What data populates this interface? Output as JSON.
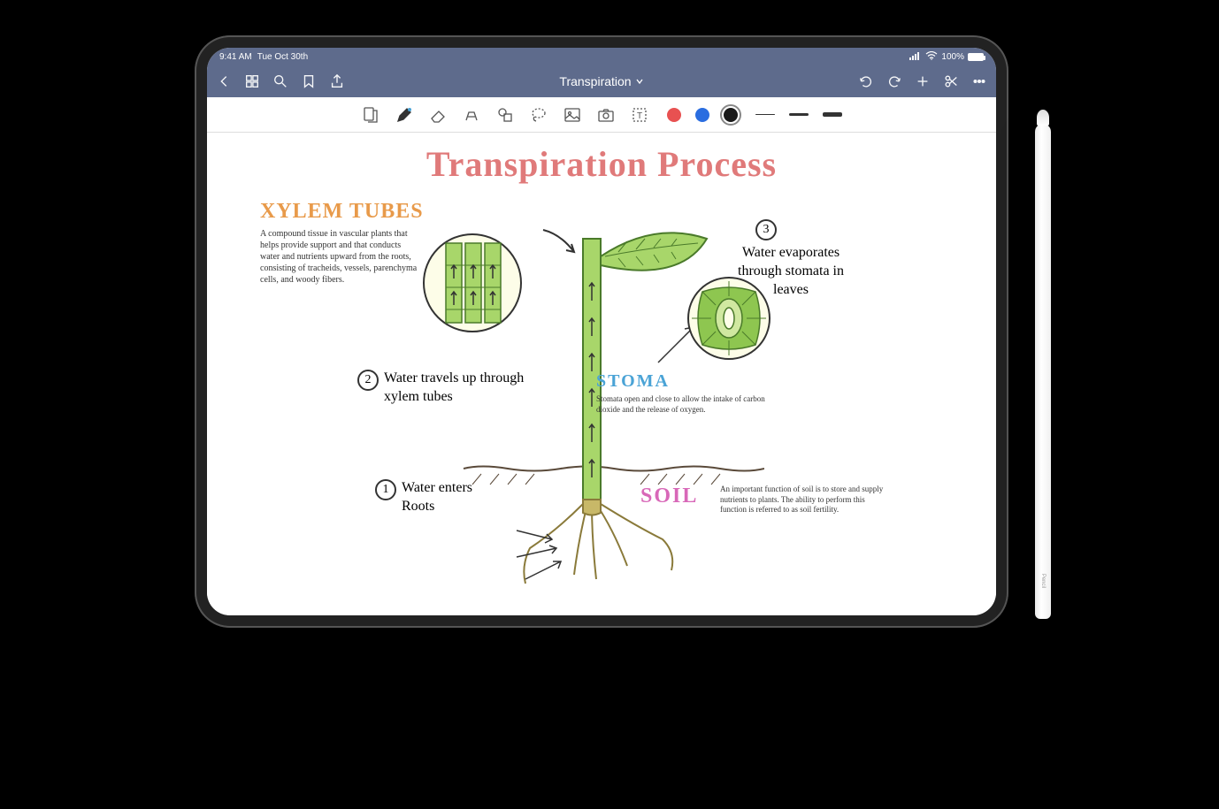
{
  "status_bar": {
    "time": "9:41 AM",
    "date": "Tue Oct 30th",
    "battery_pct": "100%"
  },
  "nav": {
    "doc_title": "Transpiration"
  },
  "colors": {
    "red": "#e85151",
    "blue": "#2a6de0",
    "black": "#1a1a1a"
  },
  "canvas": {
    "title": "Transpiration Process",
    "xylem_heading": "XYLEM TUBES",
    "xylem_text": "A compound tissue in vascular plants that helps provide support and that conducts water and nutrients upward from the roots, consisting of tracheids, vessels, parenchyma cells, and woody fibers.",
    "step1_num": "1",
    "step1_text": "Water enters Roots",
    "step2_num": "2",
    "step2_text": "Water travels up through xylem tubes",
    "step3_num": "3",
    "step3_text": "Water evaporates through stomata in leaves",
    "stoma_heading": "STOMA",
    "stoma_text": "Stomata open and close to allow the intake of carbon dioxide and the release of oxygen.",
    "soil_heading": "SOIL",
    "soil_text": "An important function of soil is to store and supply nutrients to plants. The ability to perform this function is referred to as soil fertility."
  },
  "pencil": {
    "label": " Pencil"
  }
}
